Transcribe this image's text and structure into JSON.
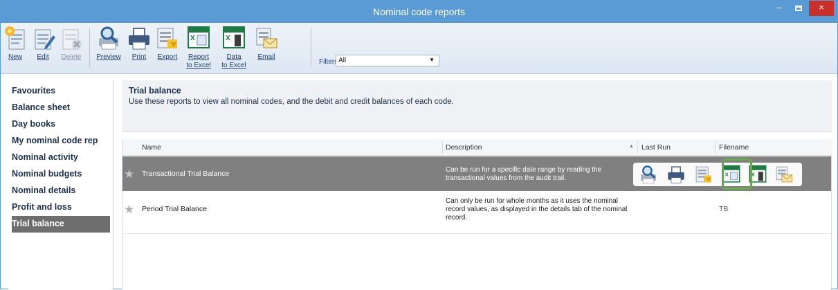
{
  "window": {
    "title": "Nominal code reports",
    "minimize": "–",
    "close": "×"
  },
  "toolbar": {
    "buttons": [
      {
        "label": "New",
        "icon": "new-report-icon"
      },
      {
        "label": "Edit",
        "icon": "edit-report-icon"
      },
      {
        "label": "Delete",
        "icon": "delete-report-icon"
      },
      {
        "label": "Preview",
        "icon": "preview-icon"
      },
      {
        "label": "Print",
        "icon": "print-icon"
      },
      {
        "label": "Export",
        "icon": "export-icon"
      },
      {
        "label": "Report",
        "label2": "to Excel",
        "icon": "report-to-excel-icon"
      },
      {
        "label": "Data",
        "label2": "to Excel",
        "icon": "data-to-excel-icon"
      },
      {
        "label": "Email",
        "icon": "email-icon"
      }
    ],
    "filters_label": "Filters",
    "filters_value": "All"
  },
  "sidebar": {
    "items": [
      {
        "label": "Favourites"
      },
      {
        "label": "Balance sheet"
      },
      {
        "label": "Day books"
      },
      {
        "label": "My nominal code rep"
      },
      {
        "label": "Nominal activity"
      },
      {
        "label": "Nominal budgets"
      },
      {
        "label": "Nominal details"
      },
      {
        "label": "Profit and loss"
      },
      {
        "label": "Trial balance"
      }
    ],
    "active": "Trial balance"
  },
  "header": {
    "title": "Trial balance",
    "description": "Use these reports to view all nominal codes, and the debit and credit balances of each code."
  },
  "grid": {
    "columns": {
      "name": "Name",
      "description": "Description",
      "last_run": "Last Run",
      "filename": "Filename"
    },
    "rows": [
      {
        "name": "Transactional Trial Balance",
        "description": "Can be run for a specific date range by reading the transactional values from the audit trail.",
        "last_run": "",
        "filename": "",
        "selected": true
      },
      {
        "name": "Period Trial Balance",
        "description": "Can only be run for whole months as it uses the nominal record values, as displayed in the details tab of the nominal record.",
        "last_run": "",
        "filename": "TB",
        "selected": false
      }
    ],
    "row_action_icons": [
      "preview-icon",
      "print-icon",
      "export-icon",
      "report-to-excel-icon",
      "data-to-excel-icon",
      "email-icon"
    ]
  },
  "colors": {
    "title_bar": "#5b9bd5",
    "close_button": "#c9302c",
    "selected_row": "#808080",
    "highlight": "#6aa84f",
    "excel_green": "#1f7a45"
  }
}
